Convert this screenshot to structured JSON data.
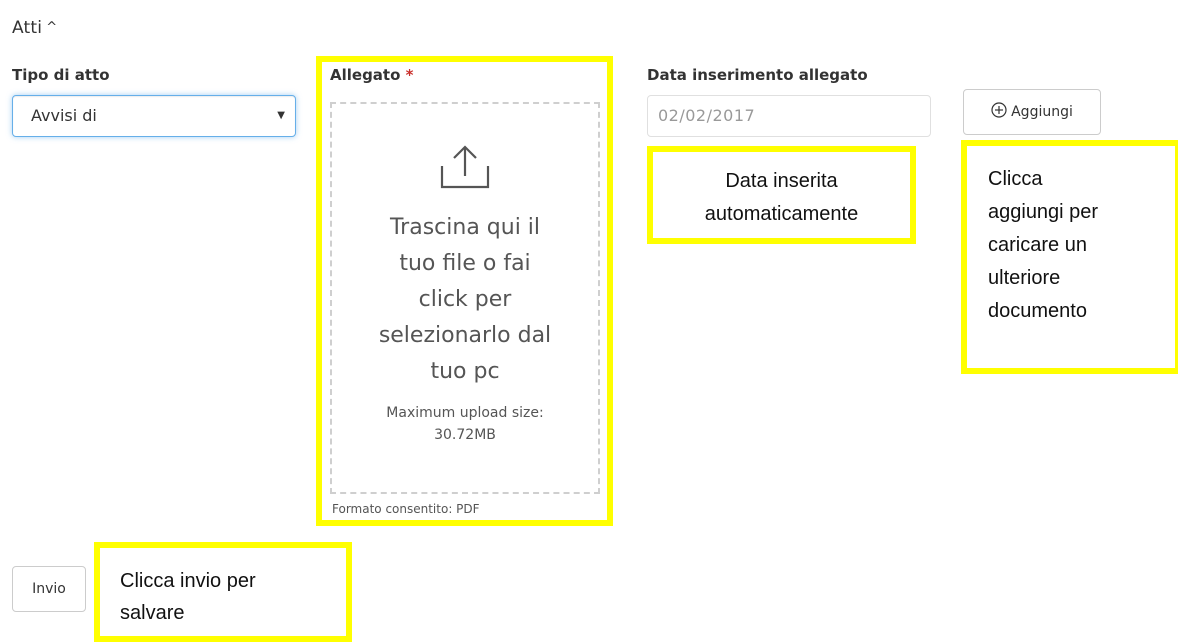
{
  "section": {
    "title": "Atti",
    "caret": "^"
  },
  "tipo_atto": {
    "label": "Tipo di atto",
    "selected": "Avvisi di",
    "arrow": "▼"
  },
  "allegato": {
    "label": "Allegato",
    "required_mark": "*",
    "dropzone_lines": [
      "Trascina qui il",
      "tuo file o fai",
      "click per",
      "selezionarlo dal",
      "tuo pc"
    ],
    "max_upload_lines": [
      "Maximum upload size:",
      "30.72MB"
    ],
    "hint": "Formato consentito: PDF",
    "icon": "upload-icon"
  },
  "data_inserimento": {
    "label": "Data inserimento allegato",
    "value": "02/02/2017"
  },
  "add_button": {
    "label": "Aggiungi",
    "icon": "plus-circle-icon"
  },
  "send_button": {
    "label": "Invio"
  },
  "callouts": {
    "date": [
      "Data inserita",
      "automaticamente"
    ],
    "add": [
      "Clicca",
      "aggiungi per",
      "caricare un",
      "ulteriore",
      "documento"
    ],
    "send": [
      "Clicca invio per",
      "salvare"
    ]
  },
  "colors": {
    "highlight": "#ffff00",
    "required": "#c9302c",
    "focus_border": "#66afe9"
  }
}
